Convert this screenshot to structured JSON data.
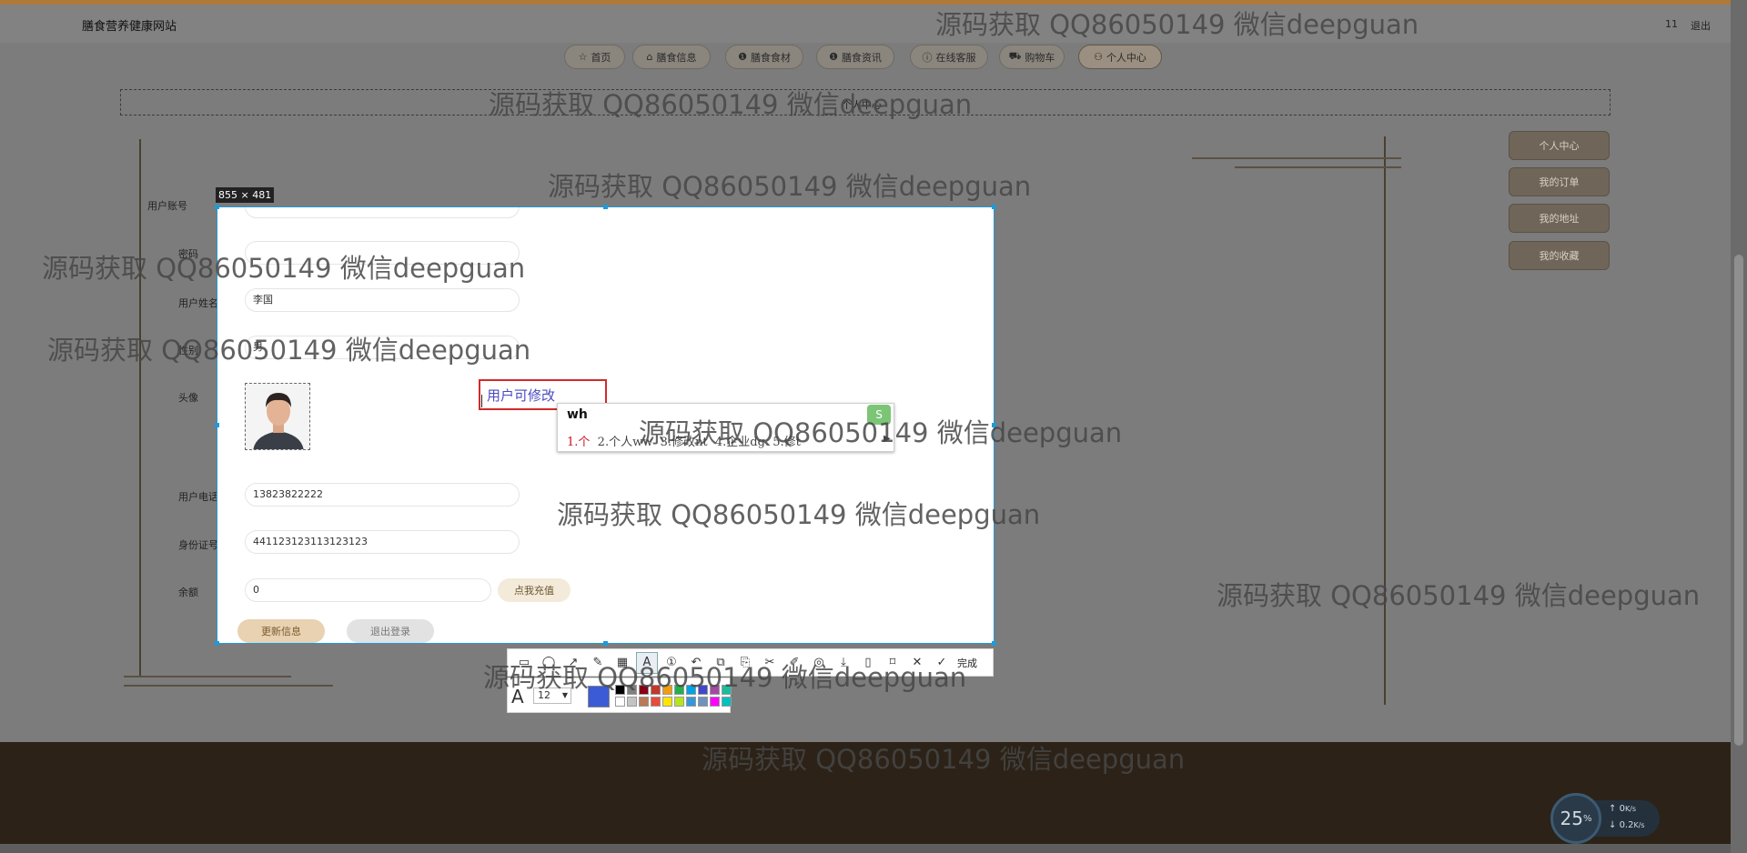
{
  "site": {
    "title": "膳食营养健康网站",
    "user": "11",
    "logout": "退出"
  },
  "nav": [
    {
      "icon": "☆",
      "label": "首页"
    },
    {
      "icon": "⌂",
      "label": "膳食信息"
    },
    {
      "icon": "❶",
      "label": "膳食食材"
    },
    {
      "icon": "❶",
      "label": "膳食资讯"
    },
    {
      "icon": "ⓘ",
      "label": "在线客服"
    },
    {
      "icon": "⛟",
      "label": "购物车"
    },
    {
      "icon": "⚇",
      "label": "个人中心"
    }
  ],
  "breadcrumb": "个人中心",
  "sidebar": [
    "个人中心",
    "我的订单",
    "我的地址",
    "我的收藏"
  ],
  "capture": {
    "size_label": "855 × 481",
    "fields": {
      "username_label": "用户账号",
      "password_label": "密码",
      "name_label": "用户姓名",
      "name_value": "李国",
      "gender_label": "性别",
      "gender_value": "男",
      "avatar_label": "头像",
      "phone_label": "用户电话",
      "phone_value": "13823822222",
      "idcard_label": "身份证号",
      "idcard_value": "441123123113123123",
      "balance_label": "余额",
      "balance_value": "0",
      "recharge_button": "点我充值",
      "update_button": "更新信息",
      "logout_button": "退出登录"
    },
    "annotation_text": "用户可修改"
  },
  "ime": {
    "input": "wh",
    "candidates": [
      "1.个",
      "2.个人ww",
      "3.修改nt",
      "4.企业dg",
      "5.修t"
    ]
  },
  "toolbar": {
    "done_label": "完成",
    "font_size": "12",
    "selected_color": "#3b5bd6",
    "palette": [
      "#000000",
      "#7f7f7f",
      "#880015",
      "#c0392b",
      "#f39c12",
      "#22b14c",
      "#00a2e8",
      "#3f48cc",
      "#a349a4",
      "#1abc9c",
      "#ffffff",
      "#c3c3c3",
      "#b97a57",
      "#e74c3c",
      "#ffe600",
      "#b5e61d",
      "#3498db",
      "#7092be",
      "#ff00ff",
      "#00c0c0"
    ]
  },
  "watermark": "源码获取 QQ86050149 微信deepguan",
  "speed_widget": {
    "percent": "25",
    "percent_unit": "%",
    "upload": "0",
    "download": "0.2",
    "unit": "K/s"
  }
}
